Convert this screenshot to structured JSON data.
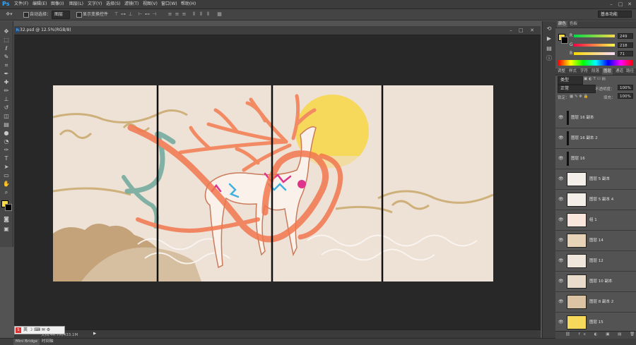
{
  "app": {
    "logo": "Ps"
  },
  "menu": [
    "文件(F)",
    "编辑(E)",
    "图像(I)",
    "图层(L)",
    "文字(Y)",
    "选择(S)",
    "滤镜(T)",
    "视图(V)",
    "窗口(W)",
    "帮助(H)"
  ],
  "options": {
    "auto_select_label": "自动选择：",
    "auto_select_value": "图层",
    "transform_label": "显示变换控件"
  },
  "workspace": "基本功能",
  "document": {
    "tab_title": "32.psd @ 12.5%(RGB/8)",
    "zoom": "12.5%",
    "doc_size": "文档:44.7M/433.1M"
  },
  "bottom_tabs": [
    "Mini Bridge",
    "时间轴"
  ],
  "color_panel": {
    "tabs": [
      "颜色",
      "色板"
    ],
    "r_label": "R",
    "g_label": "G",
    "b_label": "B",
    "r": "249",
    "g": "218",
    "b": "71",
    "fg_color": "#f9da47"
  },
  "adjust_tabs": [
    "调整",
    "样式",
    "字符",
    "段落",
    "图层",
    "通道",
    "路径"
  ],
  "layers_panel": {
    "filter_label": "类型",
    "blend_mode": "正常",
    "opacity_label": "不透明度：",
    "opacity_value": "100%",
    "lock_label": "锁定：",
    "fill_label": "填充：",
    "fill_value": "100%",
    "layers": [
      {
        "name": "图层 16 副本"
      },
      {
        "name": "图层 16 副本 2"
      },
      {
        "name": "图层 16"
      },
      {
        "name": "图层 5 副本"
      },
      {
        "name": "图层 5 副本 4"
      },
      {
        "name": "组 1"
      },
      {
        "name": "图层 14"
      },
      {
        "name": "图层 12"
      },
      {
        "name": "图层 10 副本"
      },
      {
        "name": "图层 8 副本 2"
      },
      {
        "name": "图层 15"
      }
    ]
  }
}
